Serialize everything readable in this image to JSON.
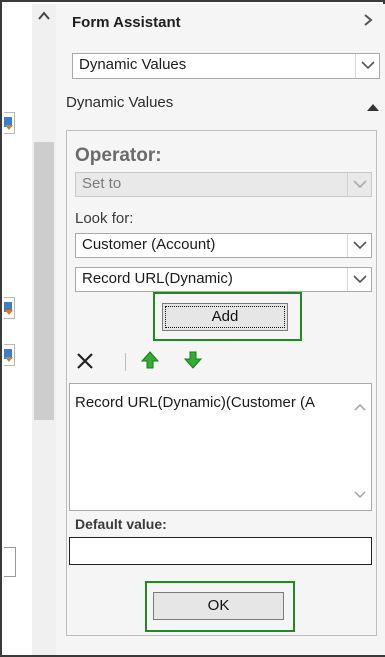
{
  "panel": {
    "title": "Form Assistant",
    "close_icon": "chevron-right-icon",
    "mode_select": {
      "value": "Dynamic Values"
    },
    "section_header": "Dynamic Values",
    "section_toggle_icon": "triangle-up-icon"
  },
  "operator": {
    "label": "Operator:",
    "select": {
      "value": "Set to",
      "disabled": true
    }
  },
  "look_for": {
    "label": "Look for:",
    "entity_select": {
      "value": "Customer (Account)"
    },
    "field_select": {
      "value": "Record URL(Dynamic)"
    }
  },
  "add_button": {
    "label": "Add"
  },
  "toolbar": {
    "delete_icon": "x-delete-icon",
    "move_up_icon": "green-arrow-up-icon",
    "move_down_icon": "green-arrow-down-icon"
  },
  "values_list": {
    "items": [
      "Record URL(Dynamic)(Customer (A"
    ]
  },
  "default_value": {
    "label": "Default value:",
    "value": ""
  },
  "ok_button": {
    "label": "OK"
  },
  "left_pane": {
    "collapse_icon": "chevron-up-icon"
  },
  "colors": {
    "highlight": "#1f8a1f",
    "arrow_green": "#2fae2f",
    "panel_bg": "#f5f5f5"
  }
}
